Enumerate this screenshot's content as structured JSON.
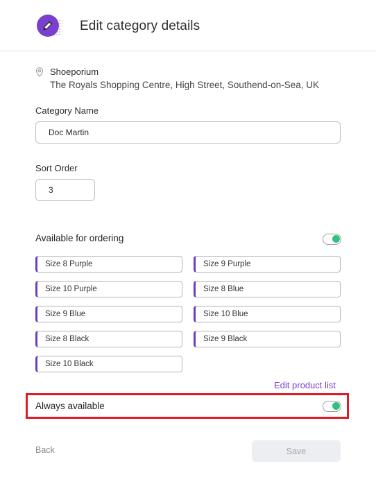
{
  "header": {
    "title": "Edit category details",
    "icon": "edit-pencil-icon",
    "icon_color": "#7b3fd0"
  },
  "location": {
    "icon": "location-pin-icon",
    "name": "Shoeporium",
    "address": "The Royals Shopping Centre, High Street, Southend-on-Sea, UK"
  },
  "category_name": {
    "label": "Category Name",
    "value": "Doc Martin"
  },
  "sort_order": {
    "label": "Sort Order",
    "value": "3"
  },
  "available_for_ordering": {
    "label": "Available for ordering",
    "enabled": true
  },
  "products": [
    "Size 8 Purple",
    "Size 9 Purple",
    "Size 10 Purple",
    "Size 8 Blue",
    "Size 9 Blue",
    "Size 10 Blue",
    "Size 8 Black",
    "Size 9 Black",
    "Size 10 Black"
  ],
  "edit_product_list": "Edit product list",
  "always_available": {
    "label": "Always available",
    "enabled": true
  },
  "footer": {
    "back_label": "Back",
    "save_label": "Save"
  },
  "colors": {
    "accent": "#7c3cd6",
    "toggle_on": "#2ec27e",
    "highlight": "#e01b24"
  }
}
